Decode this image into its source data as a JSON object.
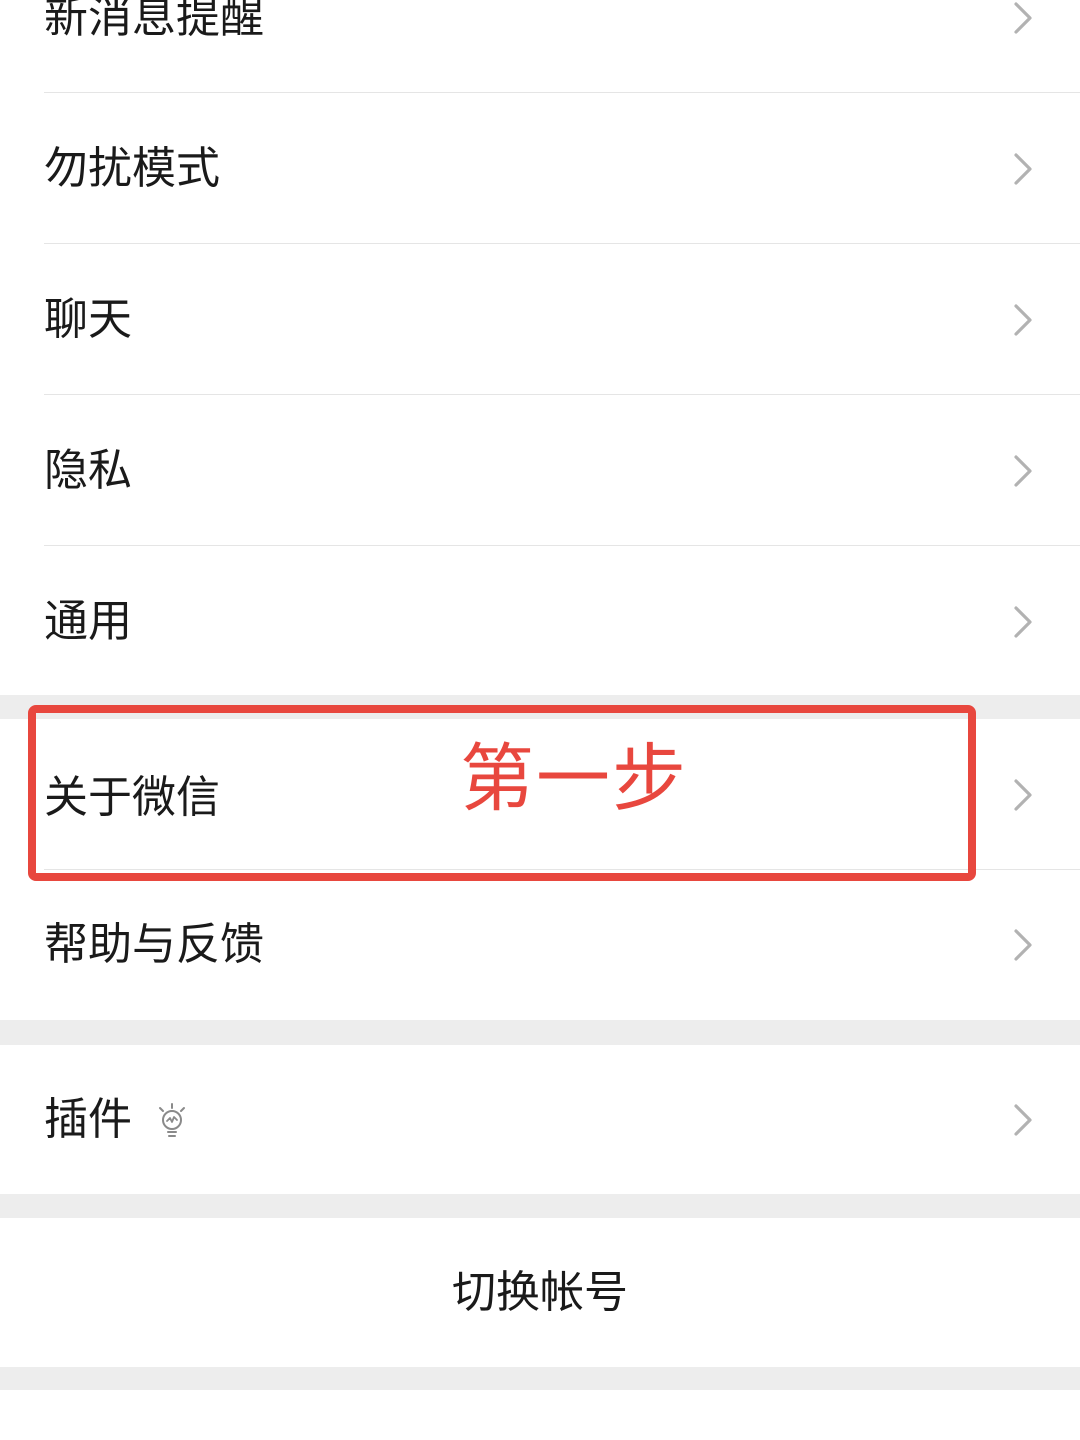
{
  "settings_list": {
    "group1": [
      {
        "label": "新消息提醒"
      },
      {
        "label": "勿扰模式"
      },
      {
        "label": "聊天"
      },
      {
        "label": "隐私"
      },
      {
        "label": "通用"
      }
    ],
    "group2": [
      {
        "label": "关于微信"
      },
      {
        "label": "帮助与反馈"
      }
    ],
    "group3": [
      {
        "label": "插件",
        "icon": "lightbulb-icon"
      }
    ],
    "switch_account": {
      "label": "切换帐号"
    }
  },
  "annotation": {
    "text": "第一步",
    "color": "#e8473e"
  },
  "icons": {
    "chevron": "chevron-right-icon"
  }
}
